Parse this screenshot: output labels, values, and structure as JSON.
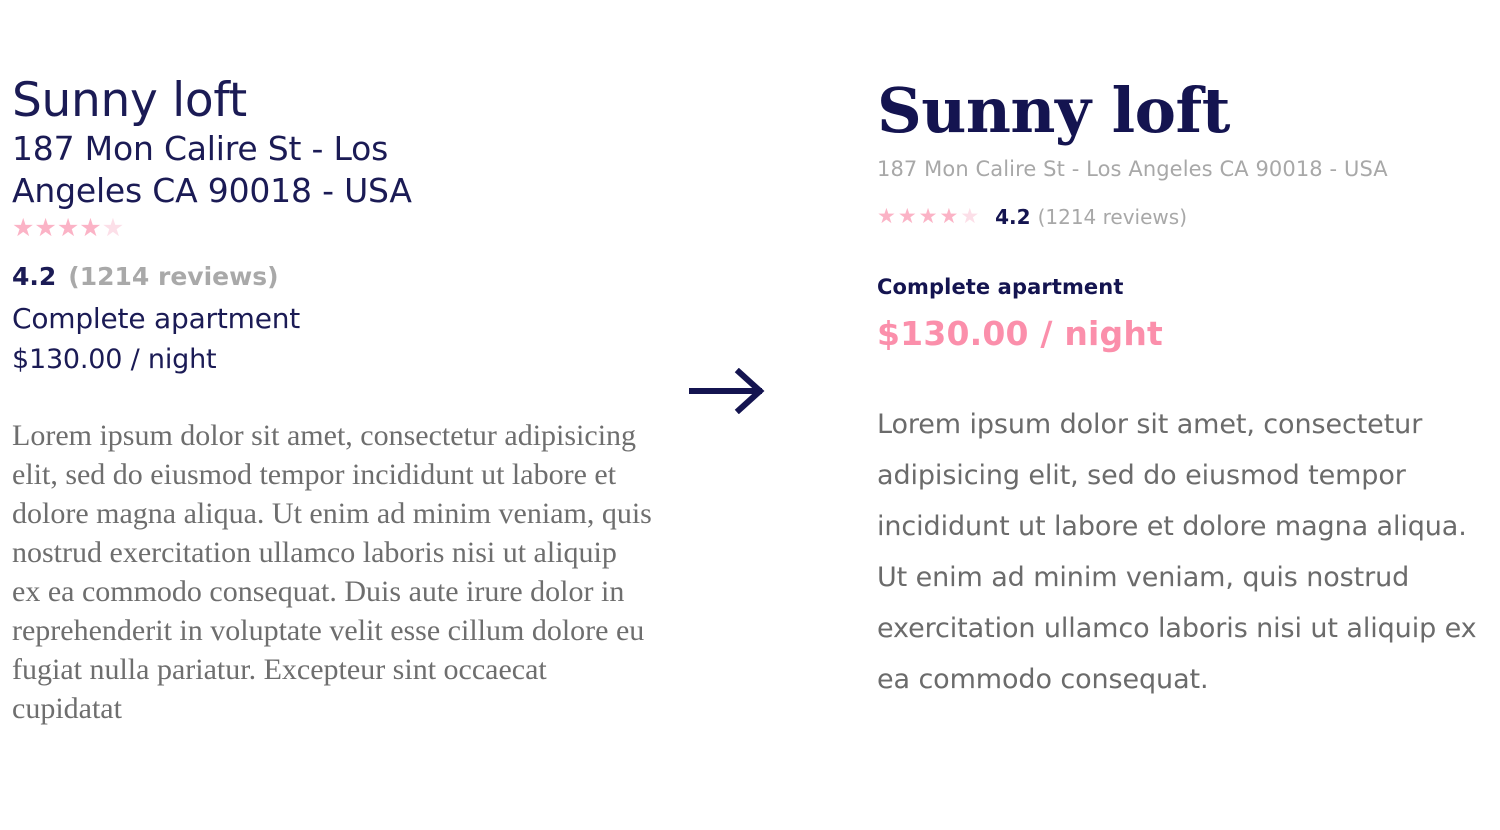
{
  "before": {
    "title": "Sunny loft",
    "address": "187 Mon Calire St - Los Angeles CA 90018 - USA",
    "rating_score": "4.2",
    "rating_count": "(1214 reviews)",
    "stars_filled": 4,
    "stars_total": 5,
    "star_icon": "star-icon",
    "apartment_type": "Complete apartment",
    "price": "$130.00 / night",
    "body": "Lorem ipsum dolor sit amet, consectetur adipisicing elit, sed do eiusmod tempor incididunt ut labore et dolore magna aliqua. Ut enim ad minim veniam, quis nostrud exercitation ullamco laboris nisi ut aliquip ex ea commodo consequat. Duis aute irure dolor in reprehenderit in voluptate velit esse cillum dolore eu fugiat nulla pariatur. Excepteur sint occaecat cupidatat"
  },
  "after": {
    "title": "Sunny loft",
    "address": "187 Mon Calire St - Los Angeles CA 90018 - USA",
    "rating_score": "4.2",
    "rating_count": "(1214 reviews)",
    "stars_filled": 4,
    "stars_total": 5,
    "star_icon": "star-icon",
    "apartment_type": "Complete apartment",
    "price": "$130.00 / night",
    "body": "Lorem ipsum dolor sit amet, consectetur adipisicing elit, sed do eiusmod tempor incididunt ut labore et dolore magna aliqua. Ut enim ad minim veniam, quis nostrud exercitation ullamco laboris nisi ut aliquip ex ea commodo consequat."
  },
  "divider": {
    "icon": "arrow-right-icon"
  },
  "colors": {
    "navy": "#1b1b55",
    "navy_deep": "#141450",
    "pink": "#fb8fab",
    "star_full": "#fbb3c6",
    "star_empty": "#fcdfe8",
    "gray_text": "#6b6b6b",
    "gray_muted": "#a8a8a8",
    "serif_body": "#6e6e6e",
    "background": "#ffffff"
  }
}
